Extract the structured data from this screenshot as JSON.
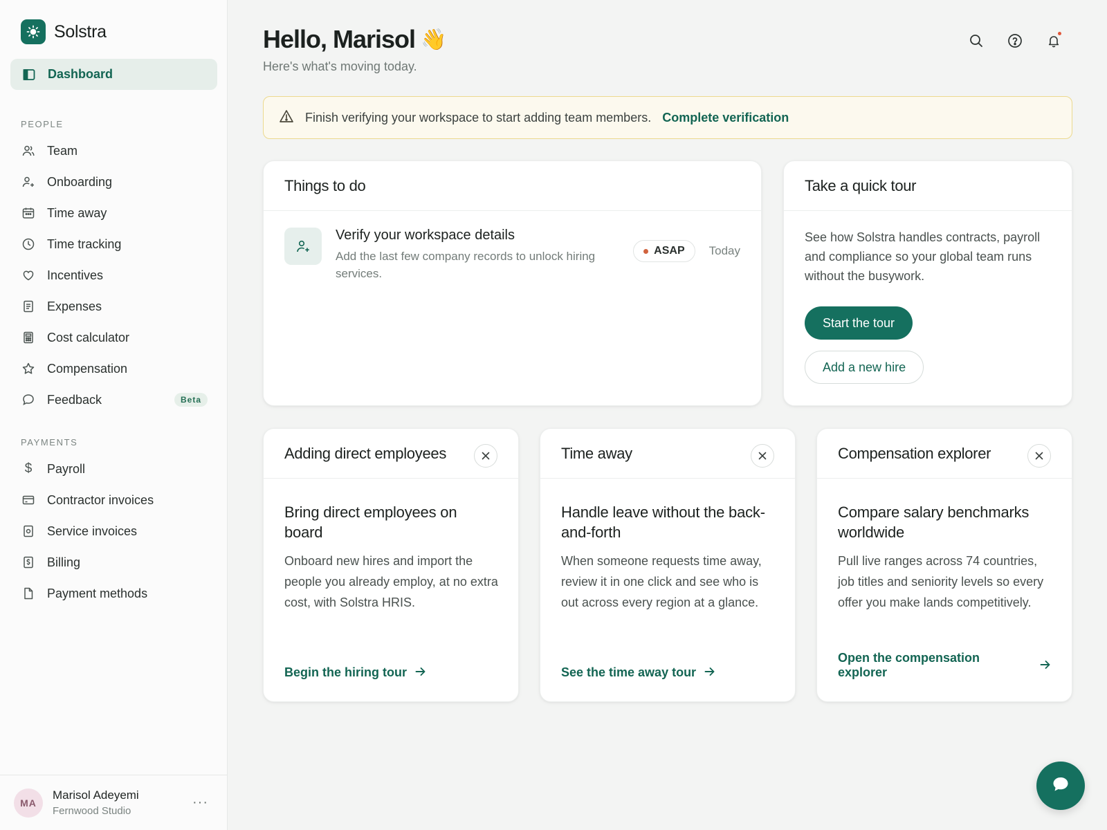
{
  "brand": {
    "name": "Solstra"
  },
  "nav": {
    "active": {
      "label": "Dashboard"
    },
    "people_label": "PEOPLE",
    "people": [
      {
        "label": "Team"
      },
      {
        "label": "Onboarding"
      },
      {
        "label": "Time away"
      },
      {
        "label": "Time tracking"
      },
      {
        "label": "Incentives"
      },
      {
        "label": "Expenses"
      },
      {
        "label": "Cost calculator"
      },
      {
        "label": "Compensation"
      },
      {
        "label": "Feedback",
        "badge": "Beta"
      }
    ],
    "payments_label": "PAYMENTS",
    "payments": [
      {
        "label": "Payroll"
      },
      {
        "label": "Contractor invoices"
      },
      {
        "label": "Service invoices"
      },
      {
        "label": "Billing"
      },
      {
        "label": "Payment methods"
      }
    ]
  },
  "user": {
    "initials": "MA",
    "name": "Marisol Adeyemi",
    "org": "Fernwood Studio",
    "more": "···"
  },
  "header": {
    "greeting": "Hello, Marisol",
    "emoji": "👋",
    "subtitle": "Here's what's moving today."
  },
  "alert": {
    "text": "Finish verifying your workspace to start adding team members.",
    "link": "Complete verification"
  },
  "todo": {
    "title": "Things to do",
    "item": {
      "title": "Verify your workspace details",
      "desc": "Add the last few company records to unlock hiring services.",
      "priority": "ASAP",
      "date": "Today"
    }
  },
  "tour": {
    "title": "Take a quick tour",
    "text": "See how Solstra handles contracts, payroll and compliance so your global team runs without the busywork.",
    "primary": "Start the tour",
    "secondary": "Add a new hire"
  },
  "features": [
    {
      "head": "Adding direct employees",
      "title": "Bring direct employees on board",
      "desc": "Onboard new hires and import the people you already employ, at no extra cost, with Solstra HRIS.",
      "link": "Begin the hiring tour"
    },
    {
      "head": "Time away",
      "title": "Handle leave without the back-and-forth",
      "desc": "When someone requests time away, review it in one click and see who is out across every region at a glance.",
      "link": "See the time away tour"
    },
    {
      "head": "Compensation explorer",
      "title": "Compare salary benchmarks worldwide",
      "desc": "Pull live ranges across 74 countries, job titles and seniority levels so every offer you make lands competitively.",
      "link": "Open the compensation explorer"
    }
  ],
  "colors": {
    "accent": "#15705f",
    "alert_bg": "#fcf9ee",
    "alert_border": "#ecd98e",
    "priority_dot": "#d1633e"
  }
}
